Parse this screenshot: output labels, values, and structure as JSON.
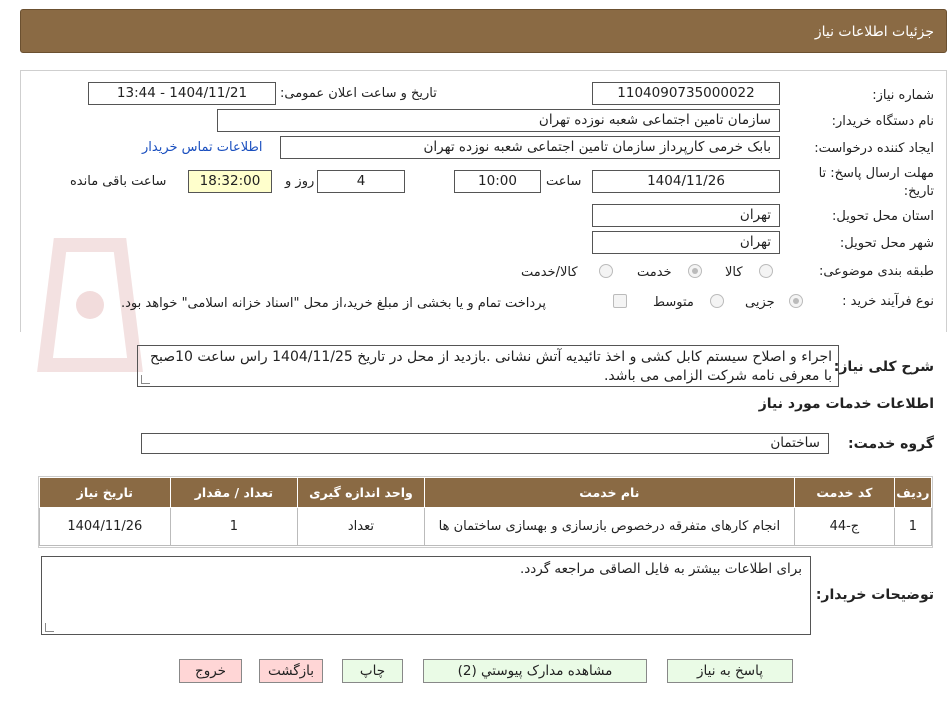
{
  "header": {
    "title": "جزئیات اطلاعات نیاز"
  },
  "form": {
    "need_number_label": "شماره نیاز:",
    "need_number": "1104090735000022",
    "announce_label": "تاریخ و ساعت اعلان عمومی:",
    "announce_value": "1404/11/21 - 13:44",
    "buyer_org_label": "نام دستگاه خریدار:",
    "buyer_org": "سازمان تامین اجتماعی شعبه نوزده تهران",
    "requester_label": "ایجاد کننده درخواست:",
    "requester": "بابک خرمی کارپرداز سازمان تامین اجتماعی شعبه نوزده تهران",
    "contact_link": "اطلاعات تماس خریدار",
    "deadline_label_1": "مهلت ارسال پاسخ: تا",
    "deadline_label_2": "تاریخ:",
    "deadline_date": "1404/11/26",
    "time_label": "ساعت",
    "deadline_time": "10:00",
    "days_value": "4",
    "days_label": "روز و",
    "remaining_time": "18:32:00",
    "remaining_label": "ساعت باقی مانده",
    "province_label": "استان محل تحویل:",
    "province": "تهران",
    "city_label": "شهر محل تحویل:",
    "city": "تهران",
    "category_label": "طبقه بندی موضوعی:",
    "category_options": [
      "کالا",
      "خدمت",
      "کالا/خدمت"
    ],
    "process_label": "نوع فرآیند خرید :",
    "process_options": [
      "جزیی",
      "متوسط"
    ],
    "payment_note": "پرداخت تمام و یا بخشی از مبلغ خرید،از محل \"اسناد خزانه اسلامی\" خواهد بود."
  },
  "description": {
    "label": "شرح کلی نیاز:",
    "text": "اجراء و اصلاح سیستم کابل کشی و اخذ تائیدیه آتش نشانی .بازدید از محل در تاریخ 1404/11/25 راس ساعت 10صبح با معرفی نامه شرکت الزامی می باشد."
  },
  "services": {
    "section_title": "اطلاعات خدمات مورد نیاز",
    "group_label": "گروه خدمت:",
    "group_value": "ساختمان",
    "columns": [
      "ردیف",
      "کد خدمت",
      "نام خدمت",
      "واحد اندازه گیری",
      "تعداد / مقدار",
      "تاریخ نیاز"
    ],
    "rows": [
      [
        "1",
        "ج-44",
        "انجام کارهای متفرقه درخصوص بازسازی و بهسازی ساختمان ها",
        "تعداد",
        "1",
        "1404/11/26"
      ]
    ]
  },
  "notes": {
    "label": "توضیحات خریدار:",
    "text": "برای اطلاعات بیشتر به فایل الصاقی مراجعه گردد."
  },
  "buttons": {
    "reply": "پاسخ به نیاز",
    "attachments": "مشاهده مدارک پیوستي (2)",
    "print": "چاپ",
    "back": "بازگشت",
    "exit": "خروج"
  },
  "colors": {
    "header_bg": "#8a6a44",
    "button_green": "#eafbe6",
    "button_red": "#ffd6d6",
    "time_box": "#ffffcc"
  }
}
